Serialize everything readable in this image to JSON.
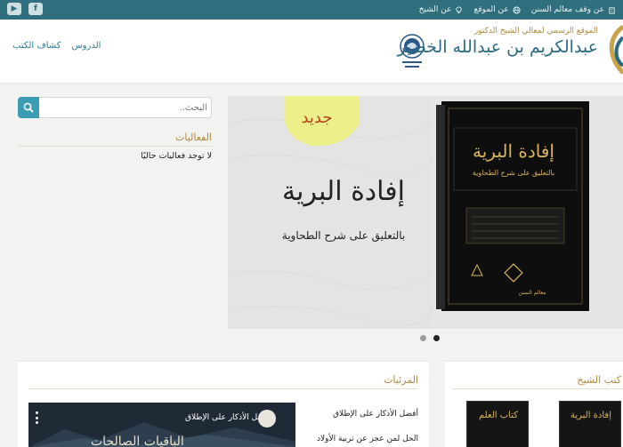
{
  "topbar": {
    "links": [
      {
        "label": "عن الشيخ",
        "icon": "bulb-icon"
      },
      {
        "label": "عن الموقع",
        "icon": "globe-icon"
      },
      {
        "label": "عن وقف معالم السنن",
        "icon": "building-icon"
      }
    ],
    "social": [
      {
        "icon": "facebook-icon",
        "glyph": "f"
      },
      {
        "icon": "youtube-icon",
        "glyph": "▶"
      }
    ]
  },
  "header": {
    "subtitle": "الموقع الرسمي لمعالي الشيخ الدكتور",
    "name": "عبدالكريم بن عبدالله الخضير",
    "nav": [
      "كشاف الكتب",
      "الدروس"
    ]
  },
  "search": {
    "placeholder": "البحث.."
  },
  "events": {
    "title": "الفعاليات",
    "empty": "لا توجد فعاليات حاليًا"
  },
  "slider": {
    "badge": "جديد",
    "title": "إفادة البرية",
    "subtitle": "بالتعليق على شرح الطحاوية",
    "book_title": "إفادة البرية",
    "book_subtitle": "بالتعليق على شرح الطحاوية",
    "publisher": "معالم السنن",
    "slides": 2,
    "active_slide": 2
  },
  "elegies": {
    "title": "المرئيات",
    "items": [
      "أفضل الأذكار على الإطلاق",
      "الحل لمن عجز عن تربية الأولاد"
    ],
    "video_title": "أفضل الأذكار على الإطلاق",
    "video_caption": "الباقيات الصالحات"
  },
  "sheikh_books": {
    "title": "كتب الشيخ",
    "books": [
      "كتاب العلم",
      "إفادة البرية"
    ]
  },
  "colors": {
    "topbar": "#2f6f7e",
    "accent": "#3a9db4",
    "gold": "#b08a3a"
  }
}
